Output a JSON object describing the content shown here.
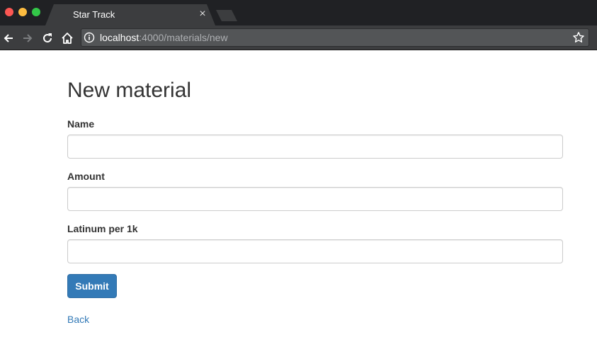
{
  "browser": {
    "tab_title": "Star Track",
    "tab_close": "×",
    "url_host": "localhost",
    "url_path": ":4000/materials/new"
  },
  "icons": {
    "back": "arrow-left-icon",
    "forward": "arrow-right-icon",
    "reload": "reload-icon",
    "home": "home-icon",
    "info": "info-icon",
    "bookmark": "star-icon",
    "close": "close-icon"
  },
  "colors": {
    "primary": "#337ab7",
    "text": "#333333",
    "chrome": "#202124"
  },
  "form": {
    "title": "New material",
    "fields": [
      {
        "label": "Name",
        "value": ""
      },
      {
        "label": "Amount",
        "value": ""
      },
      {
        "label": "Latinum per 1k",
        "value": ""
      }
    ],
    "submit_label": "Submit",
    "back_label": "Back"
  }
}
